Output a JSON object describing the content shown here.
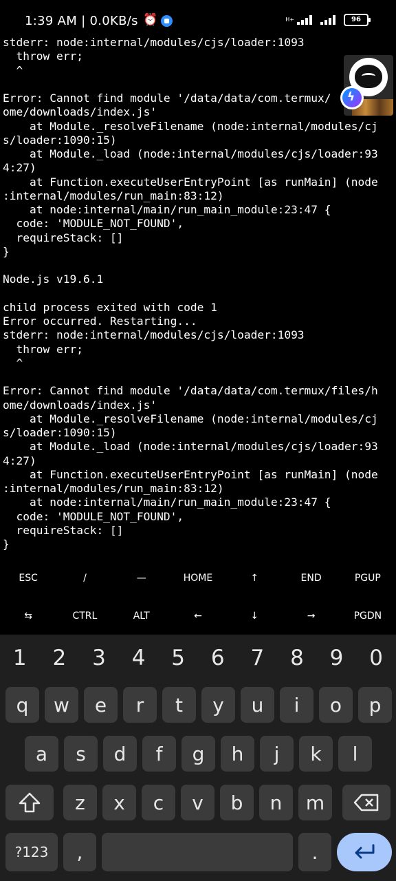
{
  "status_bar": {
    "time_speed": "1:39 AM | 0.0KB/s",
    "alarm_icon": "alarm-clock-icon",
    "net_type": "H+",
    "battery": "96"
  },
  "terminal": {
    "lines": [
      "stderr: node:internal/modules/cjs/loader:1093",
      "  throw err;",
      "  ^",
      "",
      "Error: Cannot find module '/data/data/com.termux/",
      "ome/downloads/index.js'",
      "    at Module._resolveFilename (node:internal/modules/cj",
      "s/loader:1090:15)",
      "    at Module._load (node:internal/modules/cjs/loader:93",
      "4:27)",
      "    at Function.executeUserEntryPoint [as runMain] (node",
      ":internal/modules/run_main:83:12)",
      "    at node:internal/main/run_main_module:23:47 {",
      "  code: 'MODULE_NOT_FOUND',",
      "  requireStack: []",
      "}",
      "",
      "Node.js v19.6.1",
      "",
      "child process exited with code 1",
      "Error occurred. Restarting...",
      "stderr: node:internal/modules/cjs/loader:1093",
      "  throw err;",
      "  ^",
      "",
      "Error: Cannot find module '/data/data/com.termux/files/h",
      "ome/downloads/index.js'",
      "    at Module._resolveFilename (node:internal/modules/cj",
      "s/loader:1090:15)",
      "    at Module._load (node:internal/modules/cjs/loader:93",
      "4:27)",
      "    at Function.executeUserEntryPoint [as runMain] (node",
      ":internal/modules/run_main:83:12)",
      "    at node:internal/main/run_main_module:23:47 {",
      "  code: 'MODULE_NOT_FOUND',",
      "  requireStack: []",
      "}"
    ]
  },
  "extra_keys": {
    "row1": [
      "ESC",
      "/",
      "—",
      "HOME",
      "↑",
      "END",
      "PGUP"
    ],
    "row2": [
      "⇆",
      "CTRL",
      "ALT",
      "←",
      "↓",
      "→",
      "PGDN"
    ]
  },
  "keyboard": {
    "numbers": [
      "1",
      "2",
      "3",
      "4",
      "5",
      "6",
      "7",
      "8",
      "9",
      "0"
    ],
    "row1": [
      "q",
      "w",
      "e",
      "r",
      "t",
      "y",
      "u",
      "i",
      "o",
      "p"
    ],
    "row2": [
      "a",
      "s",
      "d",
      "f",
      "g",
      "h",
      "j",
      "k",
      "l"
    ],
    "row3": [
      "z",
      "x",
      "c",
      "v",
      "b",
      "n",
      "m"
    ],
    "symbols_label": "?123",
    "comma_label": ",",
    "period_label": ".",
    "shift_icon": "shift-icon",
    "backspace_icon": "backspace-icon",
    "enter_icon": "enter-icon"
  },
  "colors": {
    "background": "#000000",
    "keyboard_bg": "#1f1f1f",
    "key_bg": "#3b3b3b",
    "enter_bg": "#a8c7fa"
  }
}
